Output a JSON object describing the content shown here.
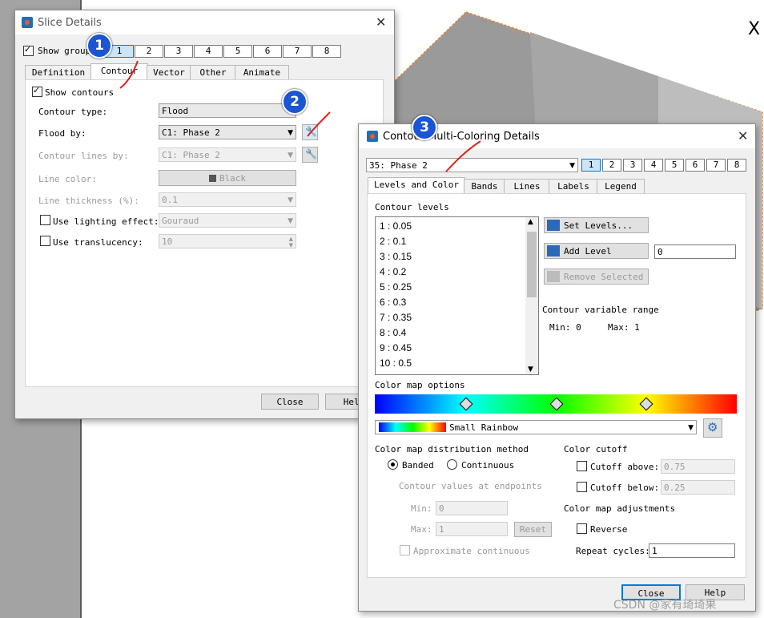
{
  "viewport": {
    "axis_label": "X"
  },
  "slice": {
    "title": "Slice Details",
    "show_group_label": "Show group",
    "groups": [
      "1",
      "2",
      "3",
      "4",
      "5",
      "6",
      "7",
      "8"
    ],
    "tabs": [
      "Definition",
      "Contour",
      "Vector",
      "Other",
      "Animate"
    ],
    "show_contours": "Show contours",
    "contour_type_label": "Contour type:",
    "contour_type_value": "Flood",
    "flood_by_label": "Flood by:",
    "flood_by_value": "C1: Phase 2",
    "lines_by_label": "Contour lines by:",
    "lines_by_value": "C1: Phase 2",
    "line_color_label": "Line color:",
    "line_color_value": "Black",
    "line_thickness_label": "Line thickness (%):",
    "line_thickness_value": "0.1",
    "lighting_label": "Use lighting effect:",
    "lighting_value": "Gouraud",
    "translucency_label": "Use translucency:",
    "translucency_value": "10",
    "close": "Close",
    "help": "Help"
  },
  "contour": {
    "title": "Contour Multi-Coloring Details",
    "var_select": "35: Phase 2",
    "groups": [
      "1",
      "2",
      "3",
      "4",
      "5",
      "6",
      "7",
      "8"
    ],
    "tabs": [
      "Levels and Color",
      "Bands",
      "Lines",
      "Labels",
      "Legend"
    ],
    "levels_label": "Contour levels",
    "levels": [
      "1 : 0.05",
      "2 : 0.1",
      "3 : 0.15",
      "4 : 0.2",
      "5 : 0.25",
      "6 : 0.3",
      "7 : 0.35",
      "8 : 0.4",
      "9 : 0.45",
      "10 : 0.5"
    ],
    "set_levels": "Set Levels...",
    "add_level": "Add Level",
    "add_level_value": "0",
    "remove_selected": "Remove Selected",
    "range_label": "Contour variable range",
    "min_text": "Min: 0",
    "max_text": "Max: 1",
    "colormap_options": "Color map options",
    "colormap_name": "Small Rainbow",
    "dist_method": "Color map distribution method",
    "banded": "Banded",
    "continuous": "Continuous",
    "endpoints": "Contour values at endpoints",
    "min_label": "Min:",
    "min_value": "0",
    "max_label": "Max:",
    "max_value": "1",
    "reset": "Reset",
    "approx": "Approximate continuous",
    "cutoff": "Color cutoff",
    "cutoff_above": "Cutoff above:",
    "cutoff_above_value": "0.75",
    "cutoff_below": "Cutoff below:",
    "cutoff_below_value": "0.25",
    "adjustments": "Color map adjustments",
    "reverse": "Reverse",
    "repeat": "Repeat cycles:",
    "repeat_value": "1",
    "close": "Close",
    "help": "Help"
  },
  "annotations": [
    "1",
    "2",
    "3"
  ],
  "watermark": "CSDN @家有琦琦果"
}
